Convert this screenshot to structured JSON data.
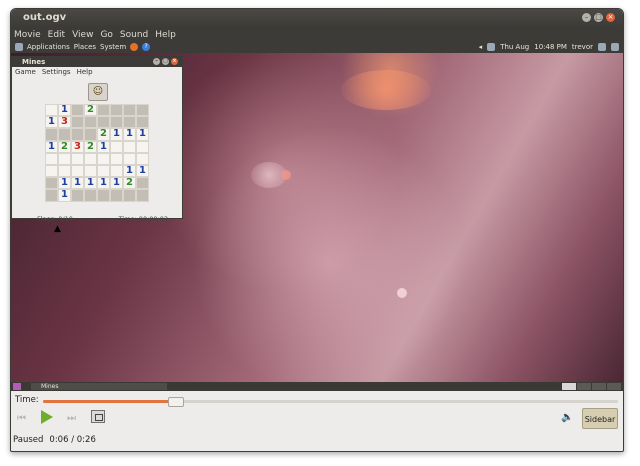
{
  "window": {
    "title": "out.ogv"
  },
  "menu": [
    "Movie",
    "Edit",
    "View",
    "Go",
    "Sound",
    "Help"
  ],
  "desktop_panel": {
    "left": [
      "Applications",
      "Places",
      "System"
    ],
    "clock": "Thu Aug",
    "time": "10:48 PM",
    "user": "trevor"
  },
  "mines": {
    "title": "Mines",
    "menu": [
      "Game",
      "Settings",
      "Help"
    ],
    "face_icon": "smiley-face-icon",
    "grid": [
      [
        "r",
        "1",
        "c",
        "2",
        "c",
        "c",
        "c",
        "c"
      ],
      [
        "1",
        "3",
        "c",
        "c",
        "c",
        "c",
        "c",
        "c"
      ],
      [
        "c",
        "c",
        "c",
        "c",
        "2",
        "1",
        "1",
        "1"
      ],
      [
        "1",
        "2",
        "3",
        "2",
        "1",
        "r",
        "r",
        "r"
      ],
      [
        "r",
        "r",
        "r",
        "r",
        "r",
        "r",
        "r",
        "r"
      ],
      [
        "r",
        "r",
        "r",
        "r",
        "r",
        "r",
        "1",
        "1"
      ],
      [
        "c",
        "1",
        "1",
        "1",
        "1",
        "1",
        "2",
        "c"
      ],
      [
        "c",
        "1",
        "c",
        "c",
        "c",
        "c",
        "c",
        "c"
      ]
    ],
    "flags": "Flags: 0/10",
    "time": "Time: 00:00:03"
  },
  "taskbar": {
    "item": "Mines"
  },
  "player": {
    "time_label": "Time:",
    "progress": 0.23,
    "sidebar_label": "Sidebar",
    "status": "Paused",
    "position": "0:06 / 0:26"
  },
  "colors": {
    "accent": "#e0733e",
    "play": "#6fae2b",
    "titlebar": "#3c3b37"
  }
}
